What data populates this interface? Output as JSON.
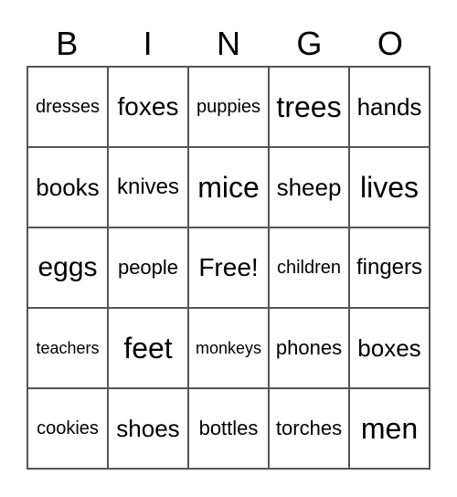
{
  "header": [
    "B",
    "I",
    "N",
    "G",
    "O"
  ],
  "cells": [
    [
      "dresses",
      "foxes",
      "puppies",
      "trees",
      "hands"
    ],
    [
      "books",
      "knives",
      "mice",
      "sheep",
      "lives"
    ],
    [
      "eggs",
      "people",
      "Free!",
      "children",
      "fingers"
    ],
    [
      "teachers",
      "feet",
      "monkeys",
      "phones",
      "boxes"
    ],
    [
      "cookies",
      "shoes",
      "bottles",
      "torches",
      "men"
    ]
  ]
}
